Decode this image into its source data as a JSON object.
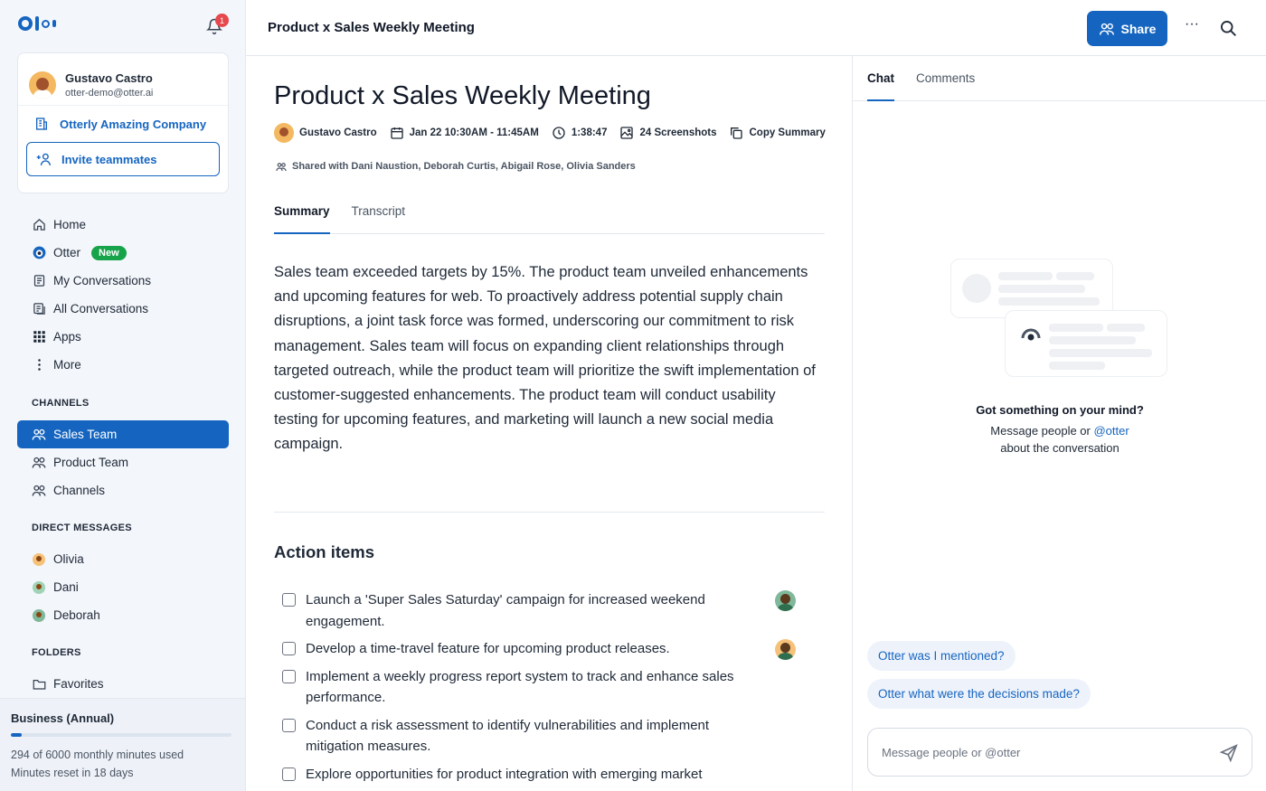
{
  "sidebar": {
    "notifications_count": "1",
    "user": {
      "name": "Gustavo Castro",
      "email": "otter-demo@otter.ai"
    },
    "company": "Otterly Amazing Company",
    "invite_label": "Invite teammates",
    "nav": [
      {
        "label": "Home",
        "icon": "home-icon"
      },
      {
        "label": "Otter",
        "icon": "otter-icon",
        "badge": "New"
      },
      {
        "label": "My Conversations",
        "icon": "document-icon"
      },
      {
        "label": "All Conversations",
        "icon": "documents-icon"
      },
      {
        "label": "Apps",
        "icon": "grid-icon"
      },
      {
        "label": "More",
        "icon": "more-vertical-icon"
      }
    ],
    "channels_title": "CHANNELS",
    "channels": [
      {
        "label": "Sales Team",
        "active": true
      },
      {
        "label": "Product Team"
      },
      {
        "label": "Channels"
      }
    ],
    "dm_title": "DIRECT MESSAGES",
    "dms": [
      {
        "label": "Olivia"
      },
      {
        "label": "Dani"
      },
      {
        "label": "Deborah"
      }
    ],
    "folders_title": "FOLDERS",
    "folders": [
      {
        "label": "Favorites"
      }
    ],
    "plan": {
      "title": "Business (Annual)",
      "usage_fraction": 0.049,
      "minutes_used": "294 of 6000 monthly minutes used",
      "reset": "Minutes reset in 18 days"
    }
  },
  "header": {
    "title": "Product x Sales Weekly Meeting",
    "share_label": "Share",
    "more_label": "···"
  },
  "meeting": {
    "title": "Product x Sales Weekly Meeting",
    "owner": "Gustavo Castro",
    "date": "Jan 22 10:30AM - 11:45AM",
    "duration": "1:38:47",
    "screenshots": "24 Screenshots",
    "copy_summary": "Copy Summary",
    "shared_with": "Shared with Dani Naustion, Deborah Curtis, Abigail Rose, Olivia Sanders",
    "tabs": [
      "Summary",
      "Transcript"
    ],
    "summary": "Sales team exceeded targets by 15%. The product team unveiled enhancements and upcoming features for web. To proactively address potential supply chain disruptions, a joint task force was formed, underscoring our commitment to risk management. Sales team will focus on expanding client relationships through targeted outreach, while the product team will prioritize the swift implementation of customer-suggested enhancements. The product team will conduct usability testing for upcoming features, and marketing will launch a new social media campaign.",
    "action_items_title": "Action items",
    "action_items": [
      {
        "text": "Launch a 'Super Sales Saturday' campaign for increased weekend engagement.",
        "assignee_color": "#7fb89a"
      },
      {
        "text": "Develop a time-travel feature for upcoming product releases.",
        "assignee_color": "#f6c27a"
      },
      {
        "text": "Implement a weekly progress report system to track and enhance sales performance."
      },
      {
        "text": "Conduct a risk assessment to identify vulnerabilities and implement mitigation measures."
      },
      {
        "text": "Explore opportunities for product integration with emerging market"
      }
    ]
  },
  "chat": {
    "tabs": [
      "Chat",
      "Comments"
    ],
    "prompt_title": "Got something on your mind?",
    "prompt_line1_prefix": "Message people or ",
    "prompt_mention": "@otter",
    "prompt_line2": "about the conversation",
    "suggestions": [
      "Otter was I mentioned?",
      "Otter what were the decisions made?"
    ],
    "input_placeholder": "Message people or @otter"
  },
  "colors": {
    "accent": "#1565c0",
    "badge_red": "#e5484d",
    "badge_green": "#16a34a"
  }
}
